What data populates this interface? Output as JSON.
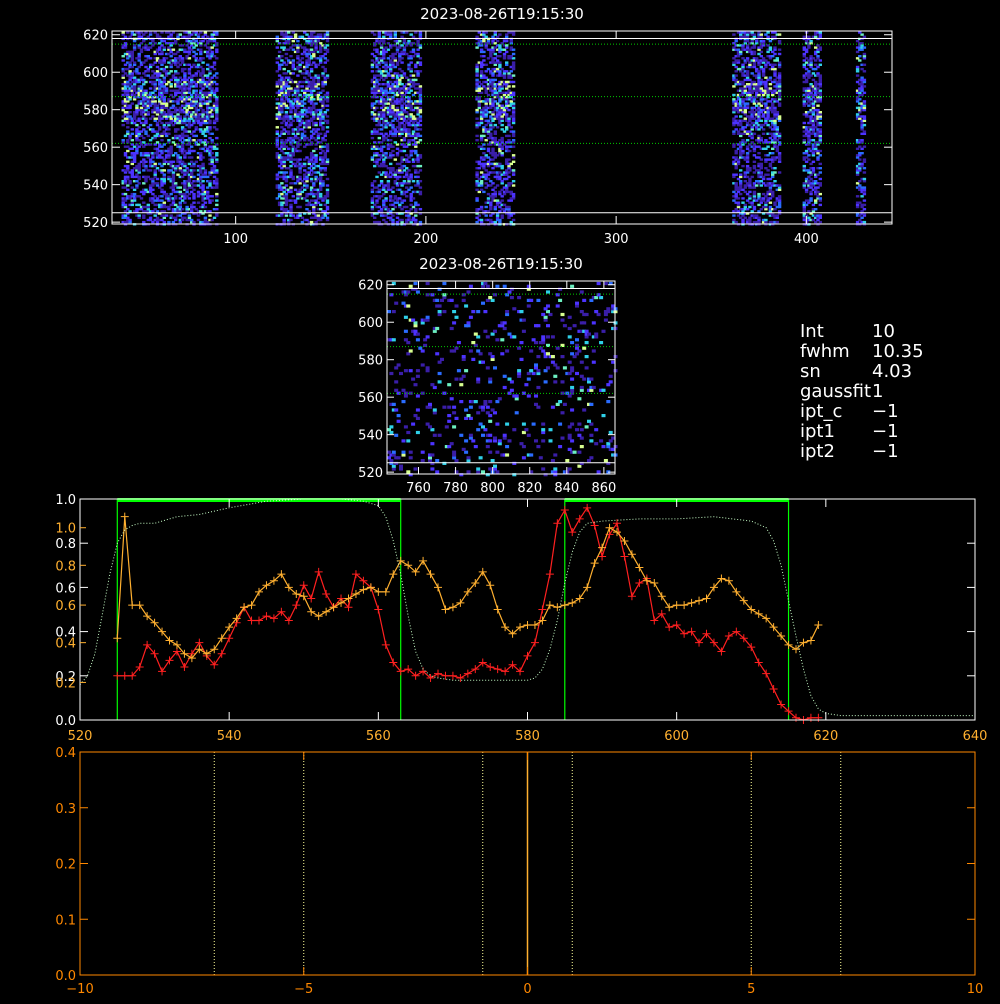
{
  "colors": {
    "white": "#ffffff",
    "green": "#00ff00",
    "red": "#ff2020",
    "orange": "#ffb030",
    "profile_dotted": "#c8ffc8",
    "lower_axes": "#ff8800",
    "lower_lines": "#ffff99",
    "lower_center": "#ffb030",
    "guide_green": "#00cc00"
  },
  "info_panel": [
    {
      "label": "Int",
      "value": "10"
    },
    {
      "label": "fwhm",
      "value": "10.35"
    },
    {
      "label": "sn",
      "value": "4.03"
    },
    {
      "label": "gaussfit",
      "value": "1"
    },
    {
      "label": "ipt_c",
      "value": "−1"
    },
    {
      "label": "ipt1",
      "value": "−1"
    },
    {
      "label": "ipt2",
      "value": "−1"
    }
  ],
  "chart_data": [
    {
      "id": "top-image",
      "type": "heatmap",
      "title": "2023-08-26T19:15:30",
      "xlim": [
        35,
        445
      ],
      "ylim": [
        519,
        622
      ],
      "x_ticks": [
        100,
        200,
        300,
        400
      ],
      "y_ticks": [
        520,
        540,
        560,
        580,
        600,
        620
      ],
      "bands_x": [
        [
          40,
          90
        ],
        [
          121,
          148
        ],
        [
          171,
          197
        ],
        [
          226,
          246
        ],
        [
          361,
          386
        ],
        [
          398,
          407
        ],
        [
          426,
          430
        ]
      ],
      "bright_rows_y": [
        580,
        585,
        590
      ],
      "h_lines_white": [
        525,
        618
      ],
      "h_lines_green": [
        562,
        587,
        615
      ]
    },
    {
      "id": "zoom-image",
      "type": "heatmap",
      "title": "2023-08-26T19:15:30",
      "xlim": [
        743,
        866
      ],
      "ylim": [
        519,
        622
      ],
      "x_ticks": [
        760,
        780,
        800,
        820,
        840,
        860
      ],
      "y_ticks": [
        520,
        540,
        560,
        580,
        600,
        620
      ],
      "h_lines_white": [
        525,
        618
      ],
      "h_lines_green": [
        562,
        587,
        615
      ]
    },
    {
      "id": "profile",
      "type": "line",
      "xlim": [
        520,
        640
      ],
      "ylim_left": [
        0.0,
        1.0
      ],
      "ylim_right": [
        0.0,
        1.0
      ],
      "x_ticks": [
        520,
        540,
        560,
        580,
        600,
        620,
        640
      ],
      "y_ticks_white": [
        "0.0",
        "0.2",
        "0.4",
        "0.6",
        "0.8",
        "1.0"
      ],
      "y_ticks_orange": [
        "0.2",
        "0.4",
        "0.6",
        "0.8",
        "1.0"
      ],
      "y_ticks_orange_values": [
        0.17,
        0.35,
        0.52,
        0.7,
        0.87
      ],
      "green_windows": [
        [
          525,
          563
        ],
        [
          585,
          615
        ]
      ],
      "series": [
        {
          "color": "red",
          "x": [
            525,
            526,
            527,
            528,
            529,
            530,
            531,
            532,
            533,
            534,
            535,
            536,
            537,
            538,
            539,
            540,
            541,
            542,
            543,
            544,
            545,
            546,
            547,
            548,
            549,
            550,
            551,
            552,
            553,
            554,
            555,
            556,
            557,
            558,
            559,
            560,
            561,
            562,
            563,
            564,
            565,
            566,
            567,
            568,
            569,
            570,
            571,
            572,
            573,
            574,
            575,
            576,
            577,
            578,
            579,
            580,
            581,
            582,
            583,
            584,
            585,
            586,
            587,
            588,
            589,
            590,
            591,
            592,
            593,
            594,
            595,
            596,
            597,
            598,
            599,
            600,
            601,
            602,
            603,
            604,
            605,
            606,
            607,
            608,
            609,
            610,
            611,
            612,
            613,
            614,
            615,
            616,
            617,
            618,
            619
          ],
          "y": [
            0.2,
            0.2,
            0.2,
            0.24,
            0.34,
            0.3,
            0.22,
            0.27,
            0.31,
            0.24,
            0.3,
            0.35,
            0.29,
            0.25,
            0.3,
            0.37,
            0.44,
            0.51,
            0.45,
            0.45,
            0.47,
            0.46,
            0.49,
            0.45,
            0.52,
            0.61,
            0.55,
            0.67,
            0.57,
            0.51,
            0.55,
            0.51,
            0.66,
            0.63,
            0.6,
            0.5,
            0.34,
            0.26,
            0.22,
            0.23,
            0.2,
            0.22,
            0.19,
            0.21,
            0.2,
            0.2,
            0.19,
            0.21,
            0.23,
            0.26,
            0.24,
            0.23,
            0.22,
            0.25,
            0.22,
            0.29,
            0.35,
            0.5,
            0.66,
            0.89,
            0.95,
            0.85,
            0.91,
            0.96,
            0.88,
            0.74,
            0.84,
            0.89,
            0.74,
            0.56,
            0.62,
            0.64,
            0.45,
            0.48,
            0.42,
            0.43,
            0.39,
            0.4,
            0.35,
            0.39,
            0.35,
            0.31,
            0.38,
            0.4,
            0.37,
            0.33,
            0.26,
            0.21,
            0.14,
            0.07,
            0.04,
            0.01,
            0.0,
            0.01,
            0.01
          ]
        },
        {
          "color": "orange",
          "x": [
            525,
            526,
            527,
            528,
            529,
            530,
            531,
            532,
            533,
            534,
            535,
            536,
            537,
            538,
            539,
            540,
            541,
            542,
            543,
            544,
            545,
            546,
            547,
            548,
            549,
            550,
            551,
            552,
            553,
            554,
            555,
            556,
            557,
            558,
            559,
            560,
            561,
            562,
            563,
            564,
            565,
            566,
            567,
            568,
            569,
            570,
            571,
            572,
            573,
            574,
            575,
            576,
            577,
            578,
            579,
            580,
            581,
            582,
            583,
            584,
            585,
            586,
            587,
            588,
            589,
            590,
            591,
            592,
            593,
            594,
            595,
            596,
            597,
            598,
            599,
            600,
            601,
            602,
            603,
            604,
            605,
            606,
            607,
            608,
            609,
            610,
            611,
            612,
            613,
            614,
            615,
            616,
            617,
            618,
            619
          ],
          "y": [
            0.37,
            0.92,
            0.52,
            0.52,
            0.47,
            0.44,
            0.4,
            0.36,
            0.34,
            0.3,
            0.28,
            0.32,
            0.3,
            0.32,
            0.37,
            0.42,
            0.46,
            0.51,
            0.52,
            0.58,
            0.61,
            0.63,
            0.66,
            0.6,
            0.57,
            0.56,
            0.49,
            0.47,
            0.49,
            0.51,
            0.53,
            0.55,
            0.57,
            0.59,
            0.6,
            0.58,
            0.58,
            0.66,
            0.72,
            0.7,
            0.67,
            0.72,
            0.66,
            0.6,
            0.5,
            0.51,
            0.53,
            0.58,
            0.62,
            0.67,
            0.61,
            0.5,
            0.42,
            0.39,
            0.42,
            0.43,
            0.43,
            0.45,
            0.52,
            0.51,
            0.52,
            0.53,
            0.55,
            0.6,
            0.71,
            0.78,
            0.87,
            0.85,
            0.81,
            0.75,
            0.69,
            0.63,
            0.62,
            0.56,
            0.51,
            0.52,
            0.52,
            0.53,
            0.54,
            0.55,
            0.6,
            0.64,
            0.63,
            0.58,
            0.54,
            0.5,
            0.48,
            0.46,
            0.42,
            0.38,
            0.34,
            0.32,
            0.35,
            0.36,
            0.43
          ]
        },
        {
          "color": "profile_dotted",
          "x": [
            520,
            521,
            522,
            523,
            524,
            525,
            526,
            527,
            528,
            530,
            533,
            536,
            540,
            545,
            550,
            555,
            558,
            560,
            561,
            562,
            563,
            564,
            565,
            566,
            567,
            568,
            570,
            575,
            580,
            581,
            582,
            583,
            584,
            585,
            586,
            587,
            588,
            590,
            595,
            600,
            605,
            610,
            612,
            613,
            614,
            615,
            616,
            617,
            618,
            619,
            620,
            622,
            625,
            630,
            635,
            640
          ],
          "y": [
            0.16,
            0.2,
            0.3,
            0.48,
            0.66,
            0.8,
            0.86,
            0.88,
            0.89,
            0.89,
            0.92,
            0.93,
            0.96,
            0.99,
            1.0,
            1.0,
            0.99,
            0.97,
            0.92,
            0.81,
            0.66,
            0.47,
            0.31,
            0.23,
            0.2,
            0.19,
            0.18,
            0.18,
            0.18,
            0.19,
            0.23,
            0.32,
            0.45,
            0.62,
            0.76,
            0.85,
            0.89,
            0.9,
            0.91,
            0.91,
            0.92,
            0.9,
            0.87,
            0.81,
            0.7,
            0.54,
            0.38,
            0.23,
            0.11,
            0.05,
            0.03,
            0.02,
            0.02,
            0.02,
            0.02,
            0.02
          ]
        }
      ]
    },
    {
      "id": "lower",
      "type": "line",
      "xlim": [
        -10,
        10
      ],
      "ylim": [
        0.0,
        0.4
      ],
      "x_ticks": [
        -10,
        -5,
        0,
        5,
        10
      ],
      "x_tick_labels": [
        "−10",
        "−5",
        "0",
        "5",
        "10"
      ],
      "y_ticks": [
        "0.0",
        "0.1",
        "0.2",
        "0.3",
        "0.4"
      ],
      "dotted_x": [
        -7,
        -5,
        -1,
        1,
        5,
        7
      ],
      "center_x": 0
    }
  ]
}
